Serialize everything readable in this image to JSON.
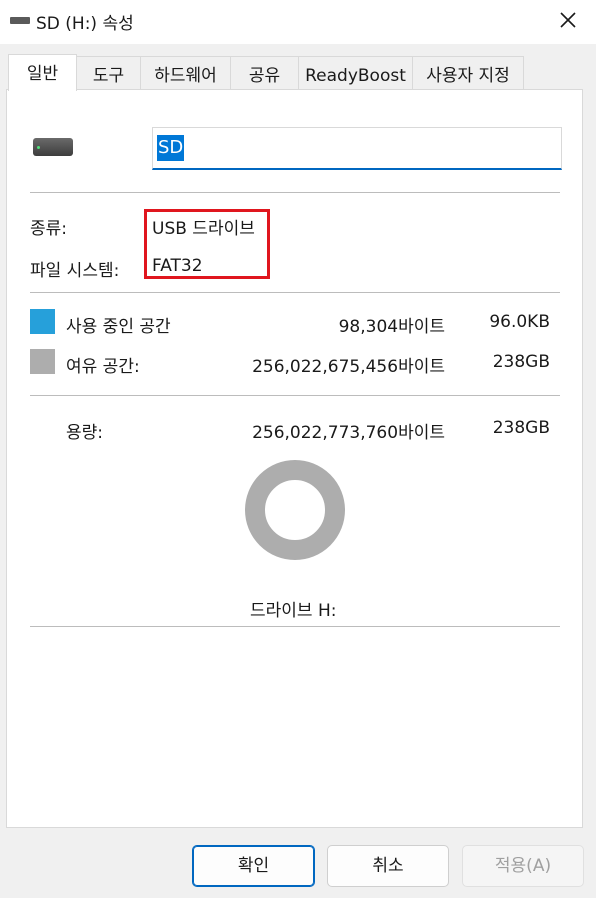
{
  "window": {
    "title": "SD (H:) 속성",
    "icon": "drive-icon",
    "close_icon": "close-icon"
  },
  "tabs": [
    {
      "label": "일반",
      "active": true
    },
    {
      "label": "도구"
    },
    {
      "label": "하드웨어"
    },
    {
      "label": "공유"
    },
    {
      "label": "ReadyBoost"
    },
    {
      "label": "사용자 지정"
    }
  ],
  "general": {
    "drive_name": "SD",
    "type_label": "종류:",
    "type_value": "USB 드라이브",
    "fs_label": "파일 시스템:",
    "fs_value": "FAT32",
    "used": {
      "label": "사용 중인 공간",
      "bytes": "98,304바이트",
      "size": "96.0KB",
      "color": "#26a0da"
    },
    "free": {
      "label": "여유 공간:",
      "bytes": "256,022,675,456바이트",
      "size": "238GB",
      "color": "#adadad"
    },
    "capacity": {
      "label": "용량:",
      "bytes": "256,022,773,760바이트",
      "size": "238GB"
    },
    "drive_caption": "드라이브 H:",
    "highlight_color": "#e0161e"
  },
  "buttons": {
    "ok": "확인",
    "cancel": "취소",
    "apply": "적용(A)",
    "apply_enabled": false
  }
}
